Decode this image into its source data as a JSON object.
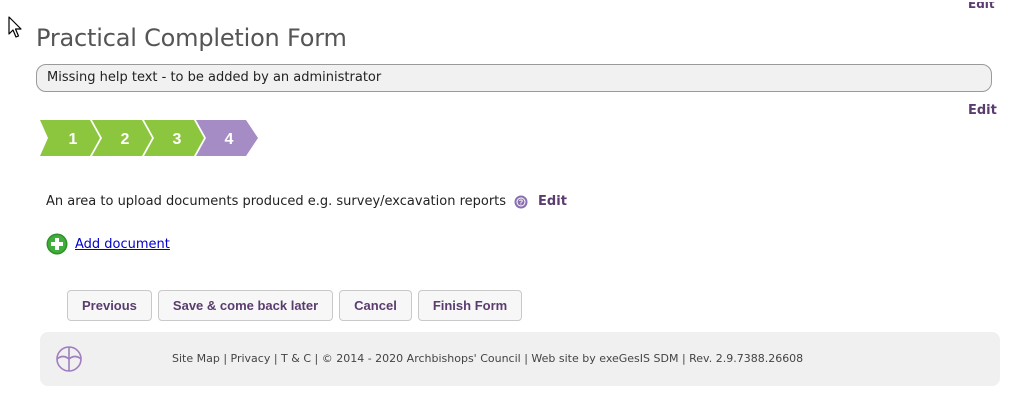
{
  "page": {
    "title": "Practical Completion Form",
    "help_text": "Missing help text - to be added by an administrator",
    "top_edit_label": "Edit",
    "help_edit_label": "Edit"
  },
  "steps": {
    "items": [
      "1",
      "2",
      "3",
      "4"
    ],
    "current": 4,
    "colors": {
      "completed": "#8cc63f",
      "current": "#a58cc4"
    }
  },
  "upload": {
    "description": "An area to upload documents produced e.g. survey/excavation reports",
    "edit_label": "Edit",
    "add_document_label": "Add document"
  },
  "buttons": {
    "previous": "Previous",
    "save_later": "Save & come back later",
    "cancel": "Cancel",
    "finish": "Finish Form"
  },
  "footer": {
    "text": "Site Map | Privacy | T & C | © 2014 - 2020 Archbishops' Council | Web site by exeGesIS SDM | Rev. 2.9.7388.26608"
  },
  "colors": {
    "accent_purple": "#5a3d6e",
    "link_blue": "#0000cc",
    "plus_green": "#3aa336"
  },
  "icons": {
    "cursor": "pointer-arrow-icon",
    "help": "question-circle-icon",
    "add": "plus-circle-icon",
    "logo": "church-cross-logo"
  }
}
